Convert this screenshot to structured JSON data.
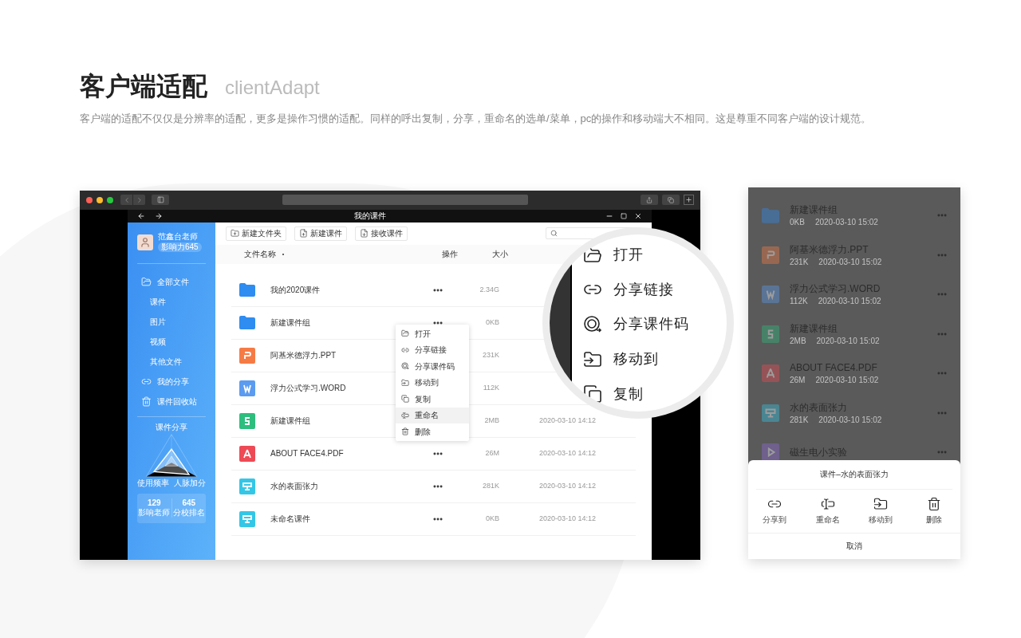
{
  "header": {
    "title": "客户端适配",
    "subtitle": "clientAdapt",
    "description": "客户端的适配不仅仅是分辨率的适配，更多是操作习惯的适配。同样的呼出复制，分享，重命名的选单/菜单，pc的操作和移动端大不相同。这是尊重不同客户端的设计规范。"
  },
  "desktop": {
    "title": "我的课件",
    "user": {
      "name": "范鑫台老师",
      "badge": "影响力645"
    },
    "nav": [
      {
        "label": "全部文件",
        "kind": "folder"
      },
      {
        "label": "课件",
        "kind": "sub"
      },
      {
        "label": "图片",
        "kind": "sub"
      },
      {
        "label": "视频",
        "kind": "sub"
      },
      {
        "label": "其他文件",
        "kind": "sub"
      },
      {
        "label": "我的分享",
        "kind": "link"
      },
      {
        "label": "课件回收站",
        "kind": "trash"
      }
    ],
    "radar": {
      "top": "课件分享",
      "left": "使用频率",
      "right": "人脉加分"
    },
    "stats": [
      {
        "value": "129",
        "label": "影响老师"
      },
      {
        "value": "645",
        "label": "分校排名"
      }
    ],
    "toolbar": [
      {
        "label": "新建文件夹",
        "kind": "folder"
      },
      {
        "label": "新建课件",
        "kind": "file"
      },
      {
        "label": "接收课件",
        "kind": "receive"
      }
    ],
    "columns": {
      "name": "文件名称",
      "actions": "操作",
      "size": "大小"
    },
    "files": [
      {
        "name": "我的2020课件",
        "kind": "folder",
        "size": "2.34G"
      },
      {
        "name": "新建课件组",
        "kind": "folder",
        "size": "0KB"
      },
      {
        "name": "阿基米德浮力.PPT",
        "kind": "ppt",
        "size": "231K"
      },
      {
        "name": "浮力公式学习.WORD",
        "kind": "word",
        "size": "112K"
      },
      {
        "name": "新建课件组",
        "kind": "sheet",
        "size": "2MB",
        "date": "2020-03-10 14:12"
      },
      {
        "name": "ABOUT FACE4.PDF",
        "kind": "pdf",
        "size": "26M",
        "date": "2020-03-10 14:12"
      },
      {
        "name": "水的表面张力",
        "kind": "slides",
        "size": "281K",
        "date": "2020-03-10 14:12"
      },
      {
        "name": "未命名课件",
        "kind": "slides",
        "size": "0KB",
        "date": "2020-03-10 14:12"
      }
    ],
    "context_menu": [
      {
        "label": "打开",
        "kind": "open",
        "selected": false
      },
      {
        "label": "分享链接",
        "kind": "link",
        "selected": false
      },
      {
        "label": "分享课件码",
        "kind": "code",
        "selected": false
      },
      {
        "label": "移动到",
        "kind": "move",
        "selected": false
      },
      {
        "label": "复制",
        "kind": "copy",
        "selected": false
      },
      {
        "label": "重命名",
        "kind": "rename",
        "selected": true
      },
      {
        "label": "删除",
        "kind": "delete",
        "selected": false
      }
    ],
    "magnifier": [
      {
        "label": "打开",
        "kind": "open"
      },
      {
        "label": "分享链接",
        "kind": "link"
      },
      {
        "label": "分享课件码",
        "kind": "code"
      },
      {
        "label": "移动到",
        "kind": "move"
      },
      {
        "label": "复制",
        "kind": "copy"
      }
    ]
  },
  "mobile": {
    "files": [
      {
        "name": "新建课件组",
        "kind": "folder",
        "size": "0KB",
        "date": "2020-03-10 15:02"
      },
      {
        "name": "阿基米德浮力.PPT",
        "kind": "ppt",
        "size": "231K",
        "date": "2020-03-10 15:02"
      },
      {
        "name": "浮力公式学习.WORD",
        "kind": "word",
        "size": "112K",
        "date": "2020-03-10 15:02"
      },
      {
        "name": "新建课件组",
        "kind": "sheet",
        "size": "2MB",
        "date": "2020-03-10 15:02"
      },
      {
        "name": "ABOUT FACE4.PDF",
        "kind": "pdf",
        "size": "26M",
        "date": "2020-03-10 15:02"
      },
      {
        "name": "水的表面张力",
        "kind": "slides",
        "size": "281K",
        "date": "2020-03-10 15:02"
      },
      {
        "name": "磁生电小实验",
        "kind": "video"
      }
    ],
    "sheet": {
      "title": "课件–水的表面张力",
      "actions": [
        {
          "label": "分享到",
          "kind": "link"
        },
        {
          "label": "重命名",
          "kind": "rename"
        },
        {
          "label": "移动到",
          "kind": "move"
        },
        {
          "label": "删除",
          "kind": "delete"
        }
      ],
      "cancel": "取消"
    }
  }
}
